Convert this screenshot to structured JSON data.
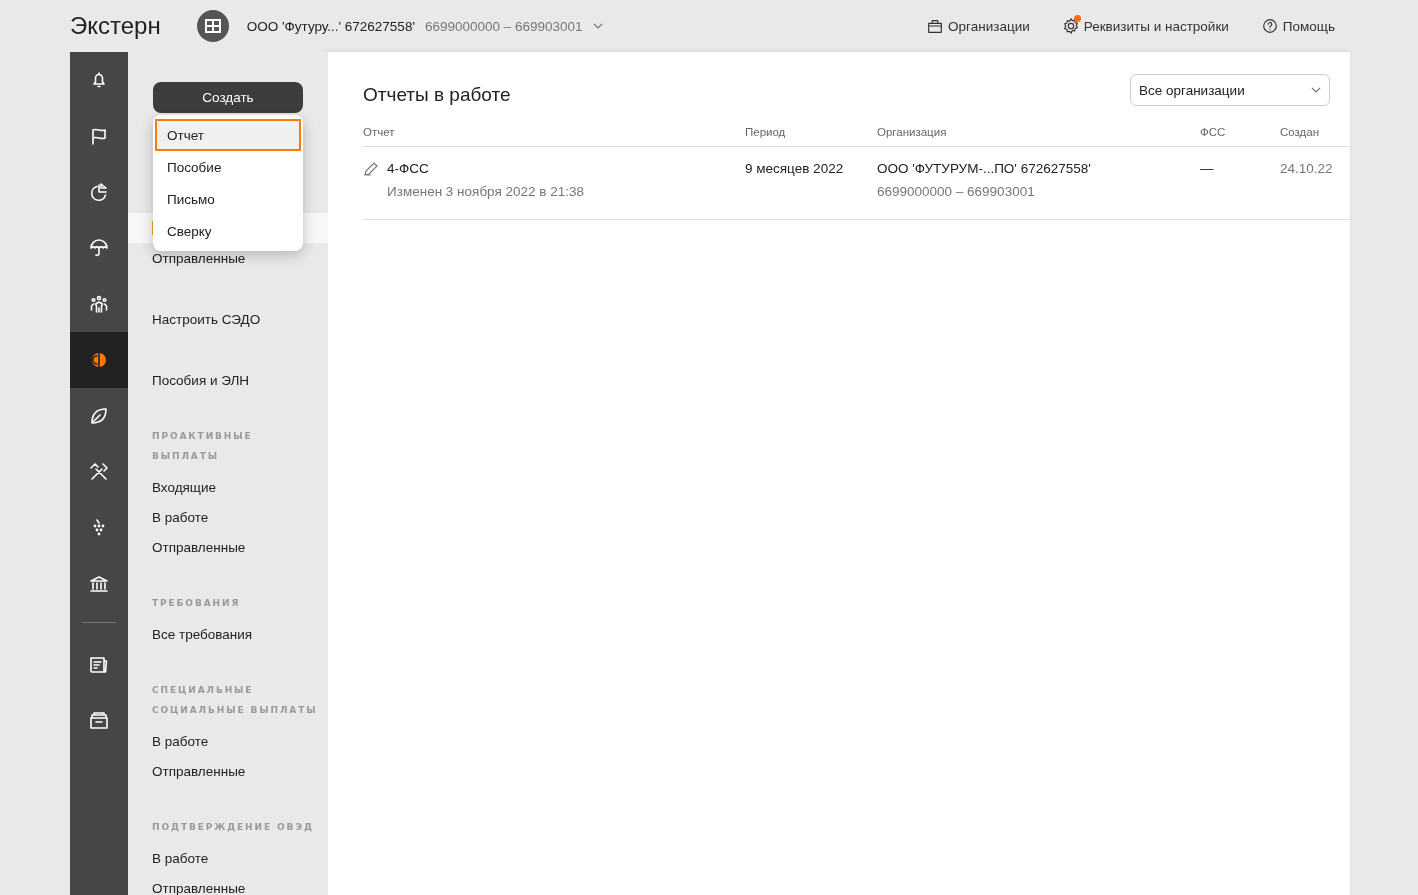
{
  "header": {
    "logo": "Экстерн",
    "org_name": "ООО 'Футуру...' 672627558'",
    "org_codes": "6699000000 – 669903001",
    "links": [
      {
        "kind": "briefcase",
        "label": "Организации",
        "badge": false
      },
      {
        "kind": "gear",
        "label": "Реквизиты и настройки",
        "badge": true
      },
      {
        "kind": "help",
        "label": "Помощь",
        "badge": false
      }
    ]
  },
  "rail": [
    {
      "items": [
        {
          "kind": "bell",
          "selected": false
        },
        {
          "kind": "flag",
          "selected": false
        },
        {
          "kind": "chart",
          "selected": false
        },
        {
          "kind": "umbrella",
          "selected": false
        },
        {
          "kind": "people",
          "selected": false
        },
        {
          "kind": "coin",
          "selected": true
        },
        {
          "kind": "leaf",
          "selected": false
        },
        {
          "kind": "tools",
          "selected": false
        },
        {
          "kind": "grapes",
          "selected": false
        },
        {
          "kind": "bank",
          "selected": false
        }
      ]
    },
    {
      "items": [
        {
          "kind": "document",
          "selected": false
        },
        {
          "kind": "folder",
          "selected": false
        }
      ]
    }
  ],
  "create_button": "Создать",
  "create_menu": [
    {
      "label": "Отчет",
      "selected": true
    },
    {
      "label": "Пособие",
      "selected": false
    },
    {
      "label": "Письмо",
      "selected": false
    },
    {
      "label": "Сверку",
      "selected": false
    }
  ],
  "nav": [
    {
      "items": [
        {
          "selected": true
        },
        {
          "label": "Отправленные",
          "selected": false
        }
      ]
    },
    {
      "items": [
        {
          "label": "Настроить СЭДО",
          "selected": false
        }
      ]
    },
    {
      "items": [
        {
          "label": "Пособия и ЭЛН",
          "selected": false
        }
      ]
    },
    {
      "heading": "ПРОАКТИВНЫЕ ВЫПЛАТЫ",
      "items": [
        {
          "label": "Входящие",
          "selected": false
        },
        {
          "label": "В работе",
          "selected": false
        },
        {
          "label": "Отправленные",
          "selected": false
        }
      ]
    },
    {
      "heading": "ТРЕБОВАНИЯ",
      "items": [
        {
          "label": "Все требования",
          "selected": false
        }
      ]
    },
    {
      "heading": "СПЕЦИАЛЬНЫЕ СОЦИАЛЬНЫЕ ВЫПЛАТЫ",
      "items": [
        {
          "label": "В работе",
          "selected": false
        },
        {
          "label": "Отправленные",
          "selected": false
        }
      ]
    },
    {
      "heading": "ПОДТВЕРЖДЕНИЕ ОВЭД",
      "items": [
        {
          "label": "В работе",
          "selected": false
        },
        {
          "label": "Отправленные",
          "selected": false
        }
      ]
    }
  ],
  "main": {
    "title": "Отчеты в работе",
    "org_filter": "Все организации",
    "table": {
      "columns": [
        "Отчет",
        "Период",
        "Организация",
        "ФСС",
        "Создан"
      ],
      "rows": [
        {
          "report": "4-ФСС",
          "modified": "Изменен 3 ноября 2022 в 21:38",
          "period": "9 месяцев 2022",
          "org": "ООО 'ФУТУРУМ-...ПО' 672627558'",
          "org_codes": "6699000000 – 669903001",
          "fss": "—",
          "created": "24.10.22"
        }
      ]
    }
  }
}
